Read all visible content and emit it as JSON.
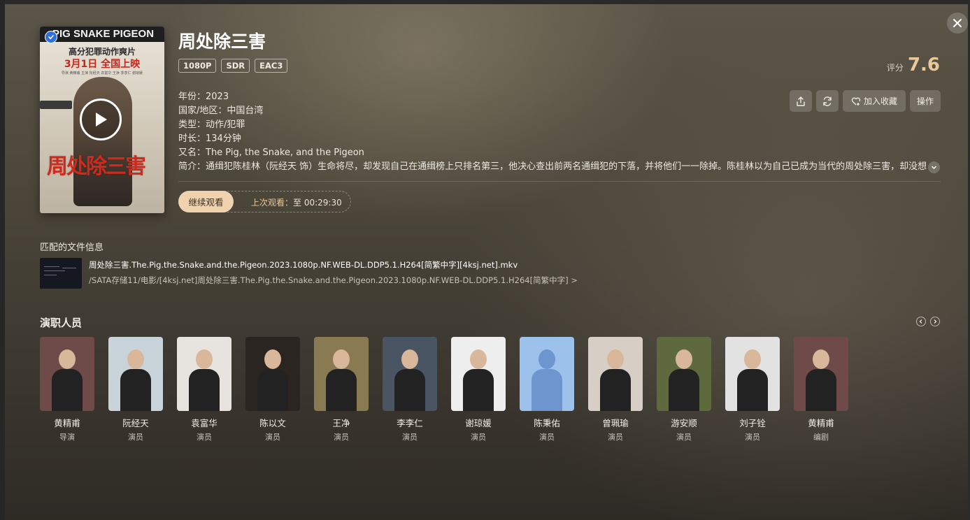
{
  "poster": {
    "brand": "PIG SNAKE PIGEON",
    "tagline": "高分犯罪动作爽片",
    "release": "3月1日  全国上映",
    "credits": "导演 黄精甫  主演 阮经天 袁富华 王净 李李仁 谢琼媛",
    "title_art": "周处除三害"
  },
  "movie": {
    "title": "周处除三害",
    "badges": [
      "1080P",
      "SDR",
      "EAC3"
    ],
    "rating_label": "评分",
    "rating_value": "7.6",
    "info": [
      "年份：2023",
      "国家/地区：中国台湾",
      "类型：动作/犯罪",
      "时长：134分钟",
      "又名：The Pig, the Snake, and the Pigeon"
    ],
    "summary": "简介：通缉犯陈桂林（阮经天 饰）生命将尽，却发现自己在通缉榜上只排名第三，他决心查出前两名通缉犯的下落，并将他们一一除掉。陈桂林以为自己已成为当代的周处除三害，却没想"
  },
  "actions": {
    "favorite_label": "加入收藏",
    "ops_label": "操作"
  },
  "playback": {
    "continue_label": "继续观看",
    "last_label": "上次观看：",
    "last_time": "至 00:29:30"
  },
  "file": {
    "section_title": "匹配的文件信息",
    "name": "周处除三害.The.Pig.the.Snake.and.the.Pigeon.2023.1080p.NF.WEB-DL.DDP5.1.H264[简繁中字][4ksj.net].mkv",
    "path": "/SATA存储11/电影/[4ksj.net]周处除三害.The.Pig.the.Snake.and.the.Pigeon.2023.1080p.NF.WEB-DL.DDP5.1.H264[简繁中字] >"
  },
  "cast_section": {
    "title": "演职人员",
    "people": [
      {
        "name": "黄精甫",
        "role": "导演",
        "bg": "#6e4a48"
      },
      {
        "name": "阮经天",
        "role": "演员",
        "bg": "#c9d4da"
      },
      {
        "name": "袁富华",
        "role": "演员",
        "bg": "#e7e4e0"
      },
      {
        "name": "陈以文",
        "role": "演员",
        "bg": "#2b2521"
      },
      {
        "name": "王净",
        "role": "演员",
        "bg": "#8a7a52"
      },
      {
        "name": "李李仁",
        "role": "演员",
        "bg": "#4a5563"
      },
      {
        "name": "谢琼媛",
        "role": "演员",
        "bg": "#eeeeee"
      },
      {
        "name": "陈秉佑",
        "role": "演员",
        "bg": "#9cc2ec"
      },
      {
        "name": "曾珮瑜",
        "role": "演员",
        "bg": "#d7cfc6"
      },
      {
        "name": "游安顺",
        "role": "演员",
        "bg": "#5e6a3e"
      },
      {
        "name": "刘子铨",
        "role": "演员",
        "bg": "#e2e2e2"
      },
      {
        "name": "黄精甫",
        "role": "编剧",
        "bg": "#6e4a48"
      }
    ]
  }
}
